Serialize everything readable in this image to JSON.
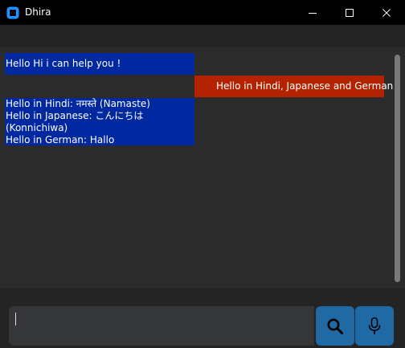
{
  "window": {
    "title": "Dhira",
    "icon": "app-icon",
    "controls": [
      "minimize-icon",
      "maximize-icon",
      "close-icon"
    ]
  },
  "chat": {
    "messages": [
      {
        "sender": "bot",
        "lines": [
          "Hello Hi i can help you !"
        ]
      },
      {
        "sender": "user",
        "lines": [
          "Hello in Hindi, Japanese and German"
        ]
      },
      {
        "sender": "bot",
        "lines": [
          "Hello in Hindi: नमस्ते (Namaste)",
          "Hello in Japanese: こんにちは",
          "(Konnichiwa)",
          "Hello in German: Hallo"
        ]
      }
    ]
  },
  "input": {
    "value": "",
    "placeholder": ""
  },
  "actions": {
    "search_icon": "search-icon",
    "mic_icon": "microphone-icon"
  },
  "colors": {
    "bot_bubble": "#0028a0",
    "user_bubble": "#b42300",
    "accent": "#1f6aa5",
    "chat_background": "#2b2b2b",
    "window_background": "#242424"
  }
}
